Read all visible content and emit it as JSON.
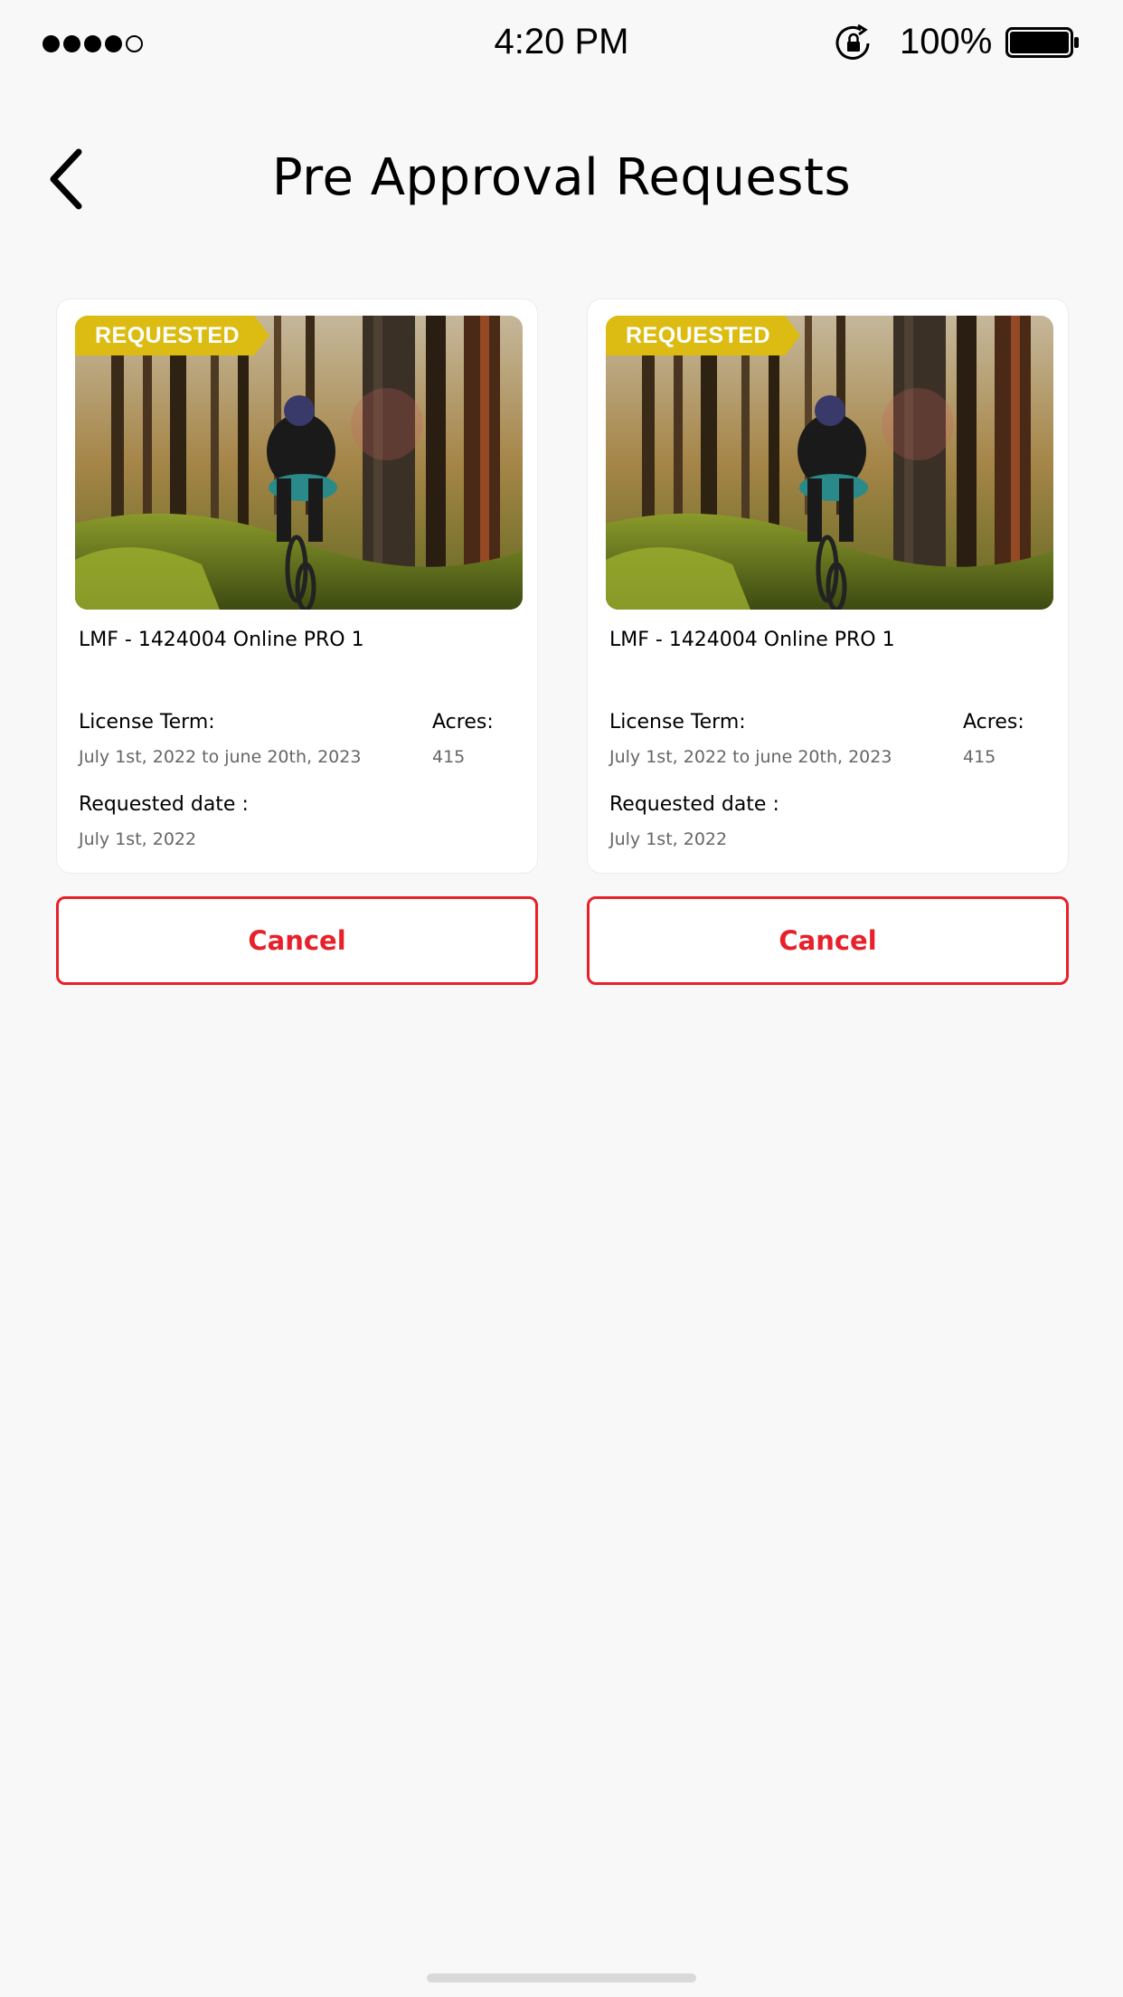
{
  "status_bar": {
    "time": "4:20 PM",
    "battery_percent": "100%",
    "signal_bars": 4,
    "signal_total": 5
  },
  "nav": {
    "title": "Pre Approval Requests",
    "back_icon": "chevron-left-icon"
  },
  "colors": {
    "badge": "#dcbc12",
    "cancel": "#e8202a",
    "background": "#f8f8f8"
  },
  "requests": [
    {
      "status": "REQUESTED",
      "title": "LMF - 1424004 Online PRO 1",
      "license_term_label": "License Term:",
      "license_term": "July 1st, 2022 to june 20th, 2023",
      "acres_label": "Acres:",
      "acres": "415",
      "requested_date_label": "Requested date :",
      "requested_date": "July 1st, 2022",
      "cancel_label": "Cancel"
    },
    {
      "status": "REQUESTED",
      "title": "LMF - 1424004 Online PRO 1",
      "license_term_label": "License Term:",
      "license_term": "July 1st, 2022 to june 20th, 2023",
      "acres_label": "Acres:",
      "acres": "415",
      "requested_date_label": "Requested date :",
      "requested_date": "July 1st, 2022",
      "cancel_label": "Cancel"
    }
  ]
}
